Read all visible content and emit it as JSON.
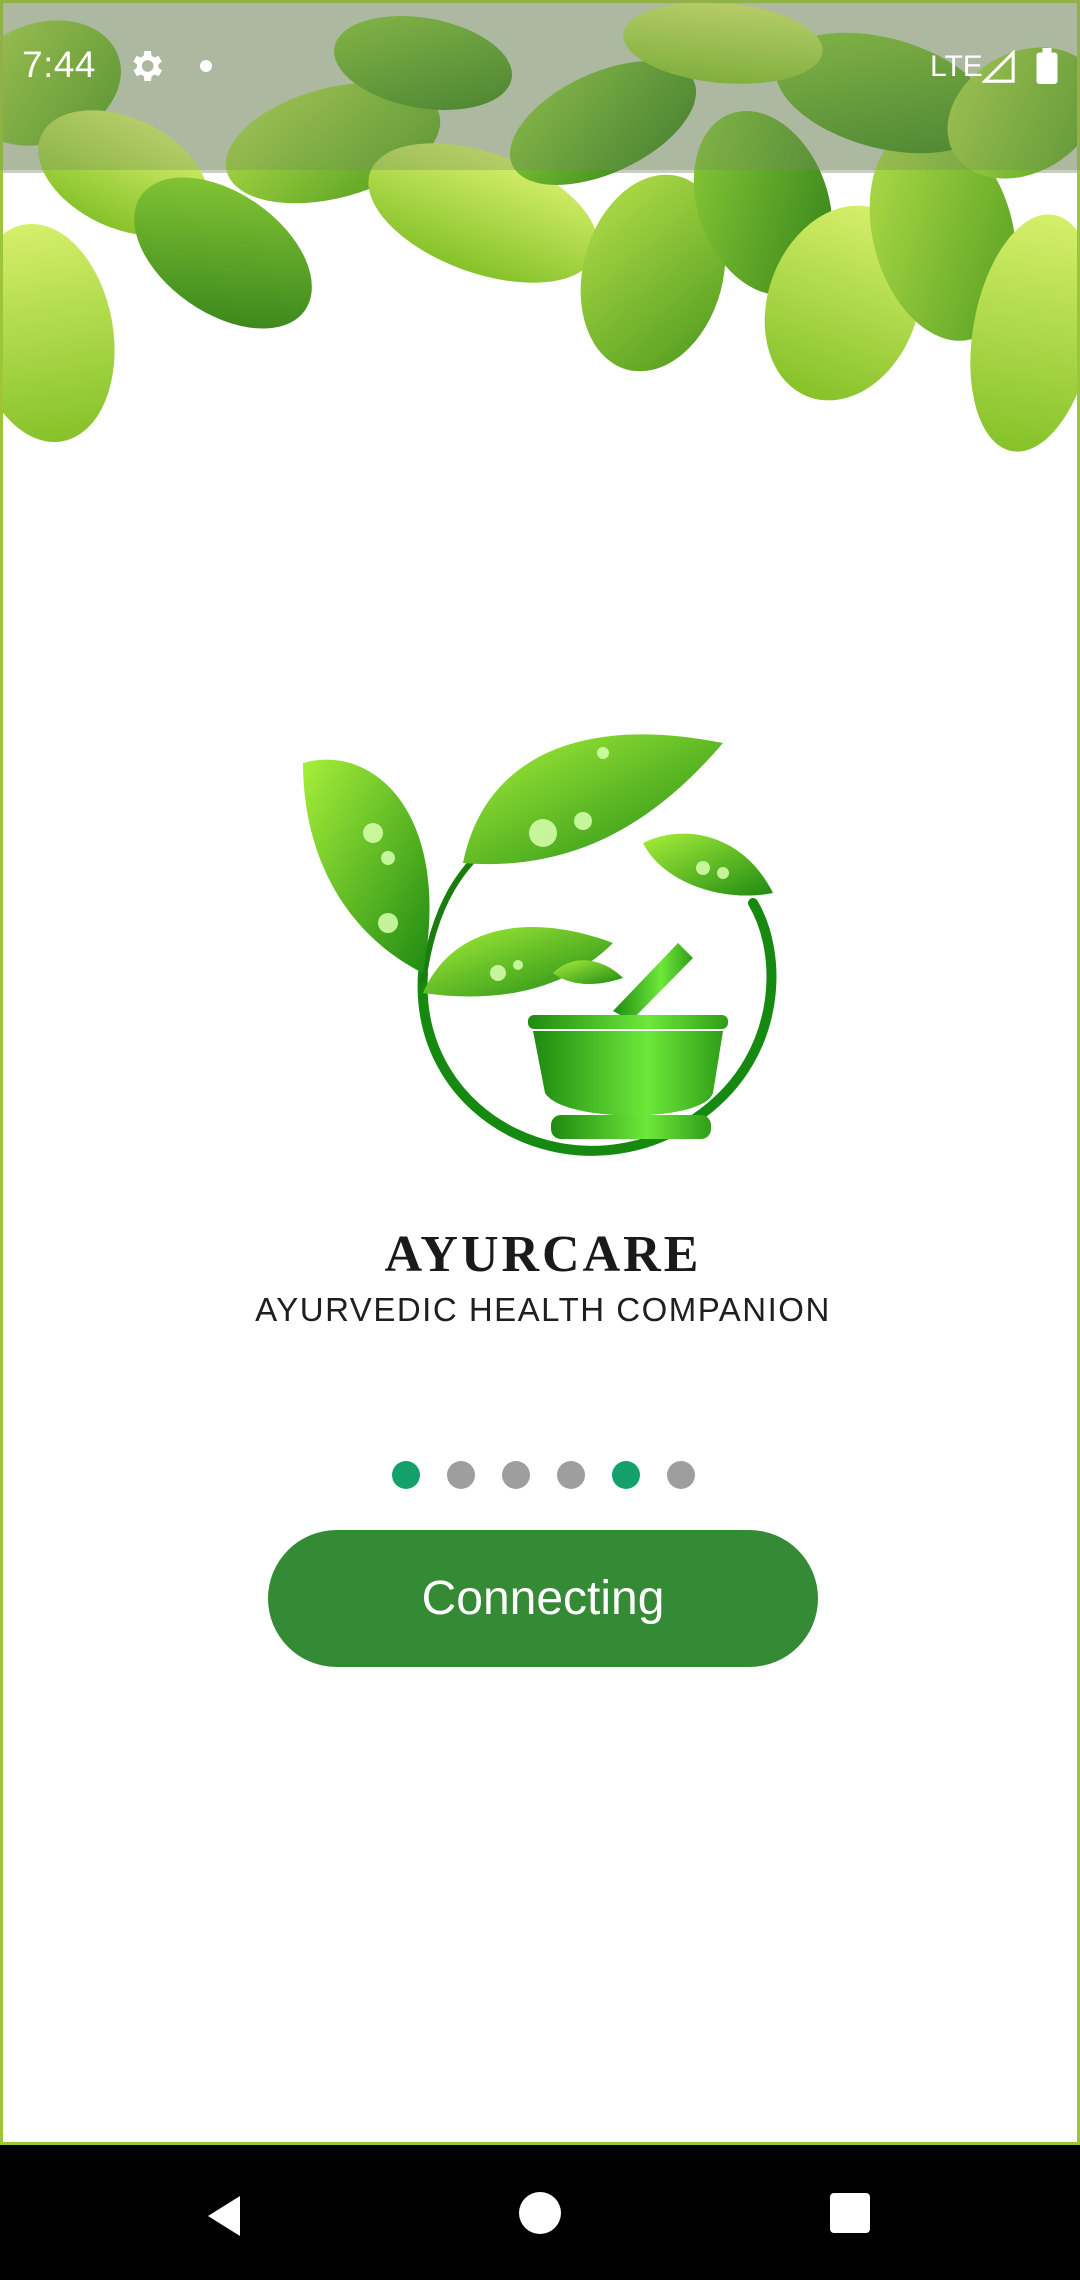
{
  "status_bar": {
    "time": "7:44",
    "network": "LTE",
    "icons": [
      "gear-icon",
      "notification-dot-icon",
      "signal-icon",
      "battery-icon"
    ]
  },
  "banner": {
    "image": "green-leaves-banner"
  },
  "logo": {
    "image": "leaves-mortar-pestle-logo",
    "title": "AYURCARE",
    "subtitle": "AYURVEDIC HEALTH COMPANION"
  },
  "pager": {
    "dots": [
      {
        "active": true
      },
      {
        "active": false
      },
      {
        "active": false
      },
      {
        "active": false
      },
      {
        "active": true
      },
      {
        "active": false
      }
    ]
  },
  "connect_button": {
    "label": "Connecting"
  },
  "nav_bar": {
    "icons": [
      "back-icon",
      "home-icon",
      "recents-icon"
    ]
  },
  "colors": {
    "accent_green": "#358a35",
    "pager_active": "#13a06b",
    "pager_inactive": "#9e9e9e",
    "frame_border": "#9cc53a"
  }
}
